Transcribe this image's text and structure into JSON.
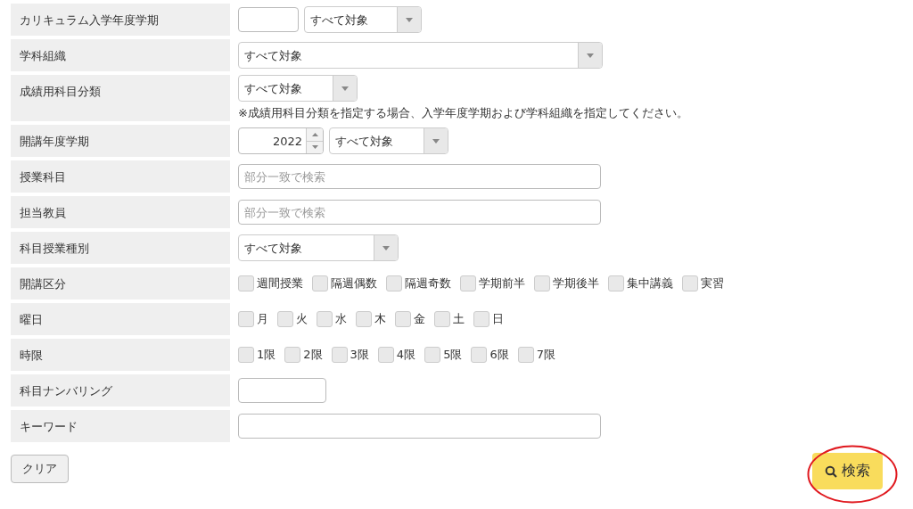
{
  "rows": [
    {
      "label": "カリキュラム入学年度学期",
      "kind": "year_select",
      "value": "",
      "option": "すべて対象"
    },
    {
      "label": "学科組織",
      "kind": "wide_select",
      "option": "すべて対象"
    },
    {
      "label": "成績用科目分類",
      "kind": "select",
      "option": "すべて対象",
      "note": "※成績用科目分類を指定する場合、入学年度学期および学科組織を指定してください。"
    },
    {
      "label": "開講年度学期",
      "kind": "spin_select",
      "value": "2022",
      "option": "すべて対象"
    },
    {
      "label": "授業科目",
      "kind": "text",
      "placeholder": "部分一致で検索"
    },
    {
      "label": "担当教員",
      "kind": "text",
      "placeholder": "部分一致で検索"
    },
    {
      "label": "科目授業種別",
      "kind": "mid_select",
      "option": "すべて対象"
    },
    {
      "label": "開講区分",
      "kind": "checks",
      "options": [
        {
          "label": "週間授業",
          "checked": false
        },
        {
          "label": "隔週偶数",
          "checked": false
        },
        {
          "label": "隔週奇数",
          "checked": false
        },
        {
          "label": "学期前半",
          "checked": false
        },
        {
          "label": "学期後半",
          "checked": false
        },
        {
          "label": "集中講義",
          "checked": false
        },
        {
          "label": "実習",
          "checked": false
        }
      ]
    },
    {
      "label": "曜日",
      "kind": "checks",
      "options": [
        {
          "label": "月",
          "checked": false
        },
        {
          "label": "火",
          "checked": false
        },
        {
          "label": "水",
          "checked": false
        },
        {
          "label": "木",
          "checked": false
        },
        {
          "label": "金",
          "checked": false
        },
        {
          "label": "土",
          "checked": false
        },
        {
          "label": "日",
          "checked": false
        }
      ]
    },
    {
      "label": "時限",
      "kind": "checks",
      "options": [
        {
          "label": "1限",
          "checked": false
        },
        {
          "label": "2限",
          "checked": false
        },
        {
          "label": "3限",
          "checked": false
        },
        {
          "label": "4限",
          "checked": false
        },
        {
          "label": "5限",
          "checked": false
        },
        {
          "label": "6限",
          "checked": false
        },
        {
          "label": "7限",
          "checked": false
        }
      ]
    },
    {
      "label": "科目ナンバリング",
      "kind": "short_input",
      "value": ""
    },
    {
      "label": "キーワード",
      "kind": "text",
      "value": ""
    }
  ],
  "buttons": {
    "clear": {
      "label": "クリア"
    },
    "search": {
      "label": "検索",
      "highlighted": true
    }
  }
}
